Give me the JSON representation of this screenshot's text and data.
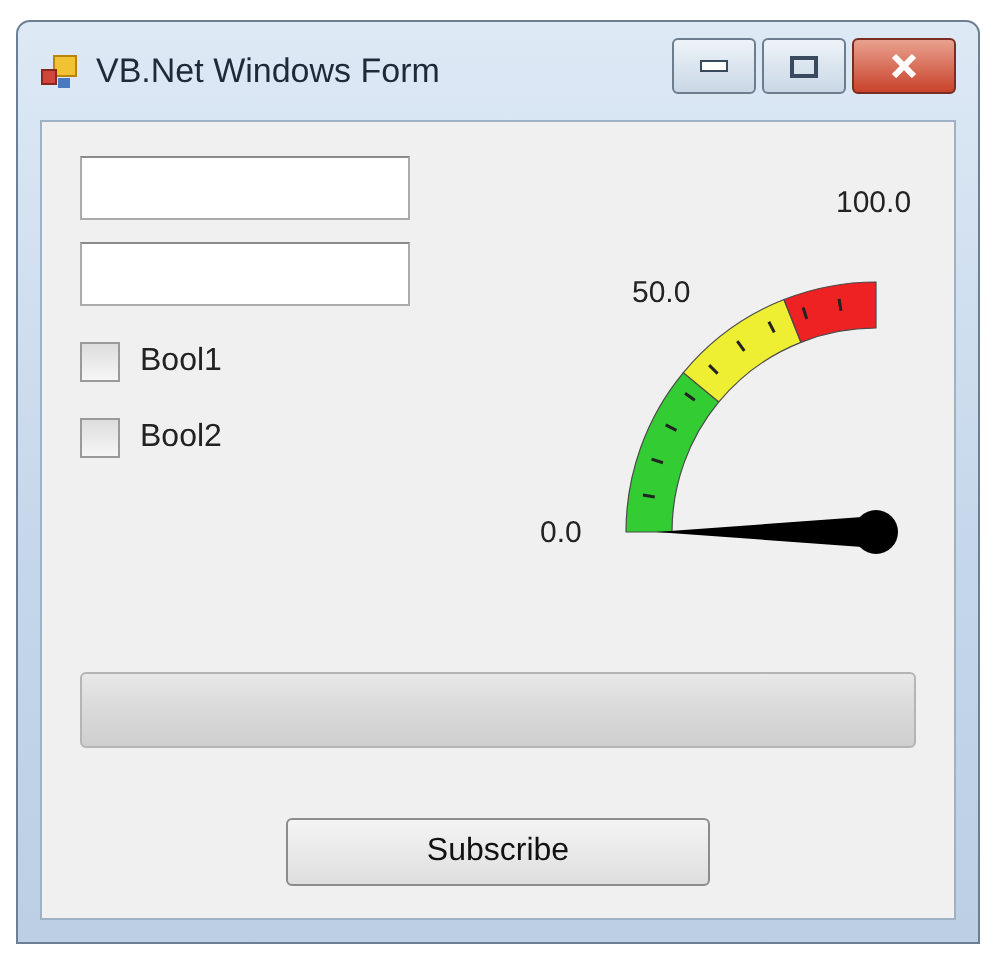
{
  "window": {
    "title": "VB.Net Windows Form"
  },
  "checkboxes": [
    {
      "label": "Bool1",
      "checked": false
    },
    {
      "label": "Bool2",
      "checked": false
    }
  ],
  "gauge": {
    "scale_labels": [
      "0.0",
      "50.0",
      "100.0"
    ],
    "bands": [
      {
        "color": "#33cc33"
      },
      {
        "color": "#eeee33"
      },
      {
        "color": "#ee2222"
      }
    ]
  },
  "progress_bar": {
    "level": 0
  },
  "buttons": [
    "Subscribe"
  ]
}
